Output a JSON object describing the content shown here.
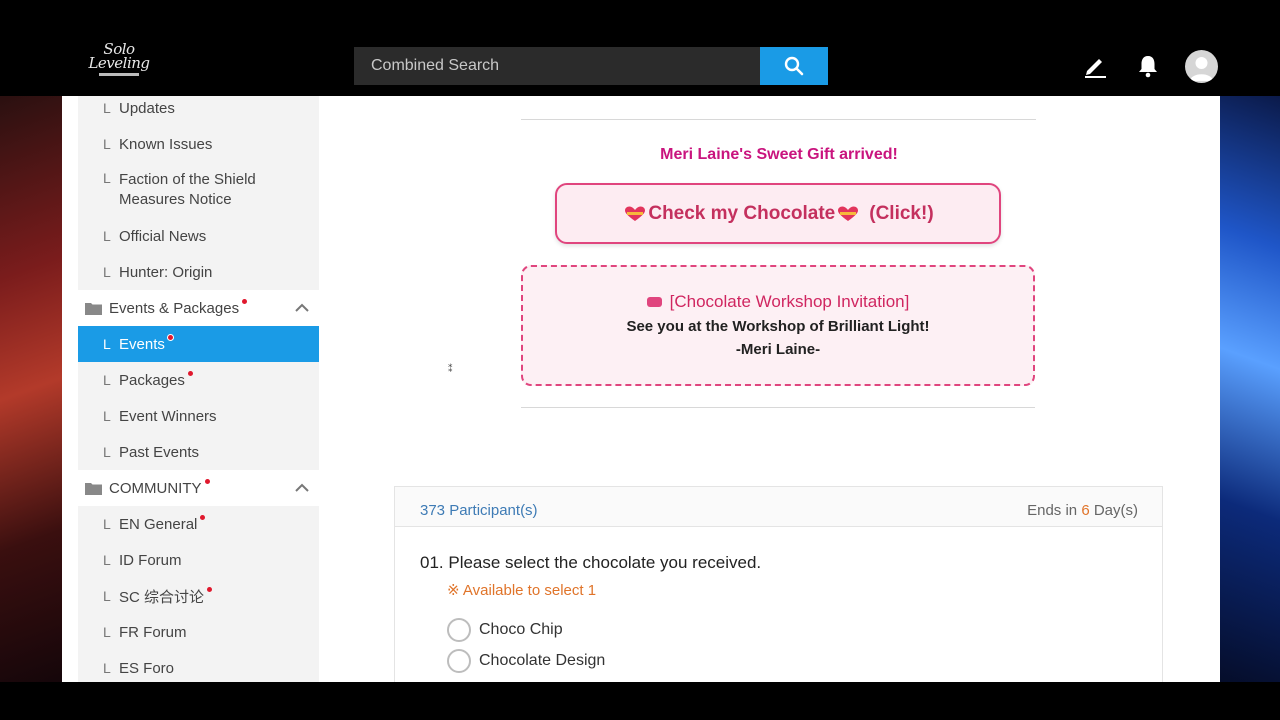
{
  "header": {
    "logo": {
      "line1": "Solo",
      "line2": "Leveling"
    },
    "search_placeholder": "Combined Search",
    "icons": [
      "search-icon",
      "pencil-icon",
      "bell-icon",
      "user-icon"
    ]
  },
  "sidebar": {
    "group_notice_items": [
      {
        "label": "Updates",
        "new": false
      },
      {
        "label": "Known Issues",
        "new": false
      },
      {
        "label": "Faction of the Shield Measures Notice",
        "new": false
      },
      {
        "label": "Official News",
        "new": false
      },
      {
        "label": "Hunter: Origin",
        "new": false
      }
    ],
    "events_category": {
      "label": "Events & Packages",
      "new": true
    },
    "events_items": [
      {
        "label": "Events",
        "new": true,
        "active": true
      },
      {
        "label": "Packages",
        "new": true
      },
      {
        "label": "Event Winners",
        "new": false
      },
      {
        "label": "Past Events",
        "new": false
      }
    ],
    "community_category": {
      "label": "COMMUNITY",
      "new": true
    },
    "community_items": [
      {
        "label": "EN General",
        "new": true
      },
      {
        "label": "ID Forum",
        "new": false
      },
      {
        "label": "SC 综合讨论",
        "new": true
      },
      {
        "label": "FR Forum",
        "new": false
      },
      {
        "label": "ES Foro",
        "new": false
      }
    ],
    "tick": "L"
  },
  "main": {
    "gift_title": "Meri Laine's Sweet Gift arrived!",
    "chocolate_button": "Check my Chocolate",
    "chocolate_button_suffix": "(Click!)",
    "invite_title": "[Chocolate Workshop Invitation]",
    "invite_line": "See you at the Workshop of Brilliant Light!",
    "invite_sign": "-Meri Laine-",
    "poll": {
      "participants": "373 Participant(s)",
      "ends_prefix": "Ends in",
      "ends_days": "6",
      "ends_suffix": "Day(s)",
      "question": "01. Please select the chocolate you received.",
      "hint": "※ Available to select 1",
      "options": [
        "Choco Chip",
        "Chocolate Design"
      ]
    }
  },
  "colors": {
    "accent": "#1a9be6",
    "pink": "#c9147e",
    "new_dot": "#e0182d",
    "orange": "#e0742a"
  }
}
